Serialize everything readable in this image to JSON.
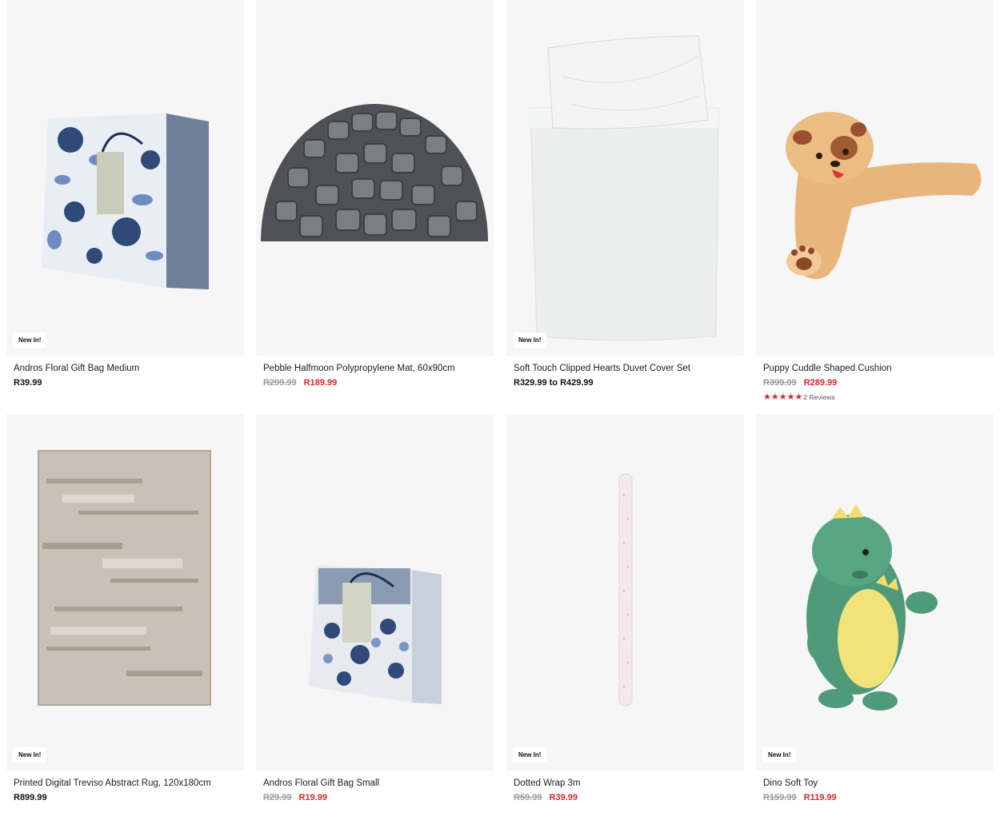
{
  "products": [
    {
      "title": "Andros Floral Gift Bag Medium",
      "price": "R39.99",
      "badge": "New In!"
    },
    {
      "title": "Pebble Halfmoon Polypropylene Mat, 60x90cm",
      "was": "R299.99",
      "now": "R189.99"
    },
    {
      "title": "Soft Touch Clipped Hearts Duvet Cover Set",
      "price": "R329.99 to R429.99",
      "badge": "New In!"
    },
    {
      "title": "Puppy Cuddle Shaped Cushion",
      "was": "R399.99",
      "now": "R289.99",
      "rating": 5,
      "reviews": "2 Reviews"
    },
    {
      "title": "Printed Digital Treviso Abstract Rug, 120x180cm",
      "price": "R899.99",
      "badge": "New In!"
    },
    {
      "title": "Andros Floral Gift Bag Small",
      "was": "R29.99",
      "now": "R19.99"
    },
    {
      "title": "Dotted Wrap 3m",
      "was": "R59.99",
      "now": "R39.99",
      "badge": "New In!"
    },
    {
      "title": "Dino Soft Toy",
      "was": "R159.99",
      "now": "R119.99",
      "badge": "New In!"
    }
  ],
  "colors": {
    "sale": "#d9262e",
    "strike": "#9a9a9a",
    "card_bg": "#f6f6f6"
  },
  "icons": {
    "star": "star-icon"
  }
}
